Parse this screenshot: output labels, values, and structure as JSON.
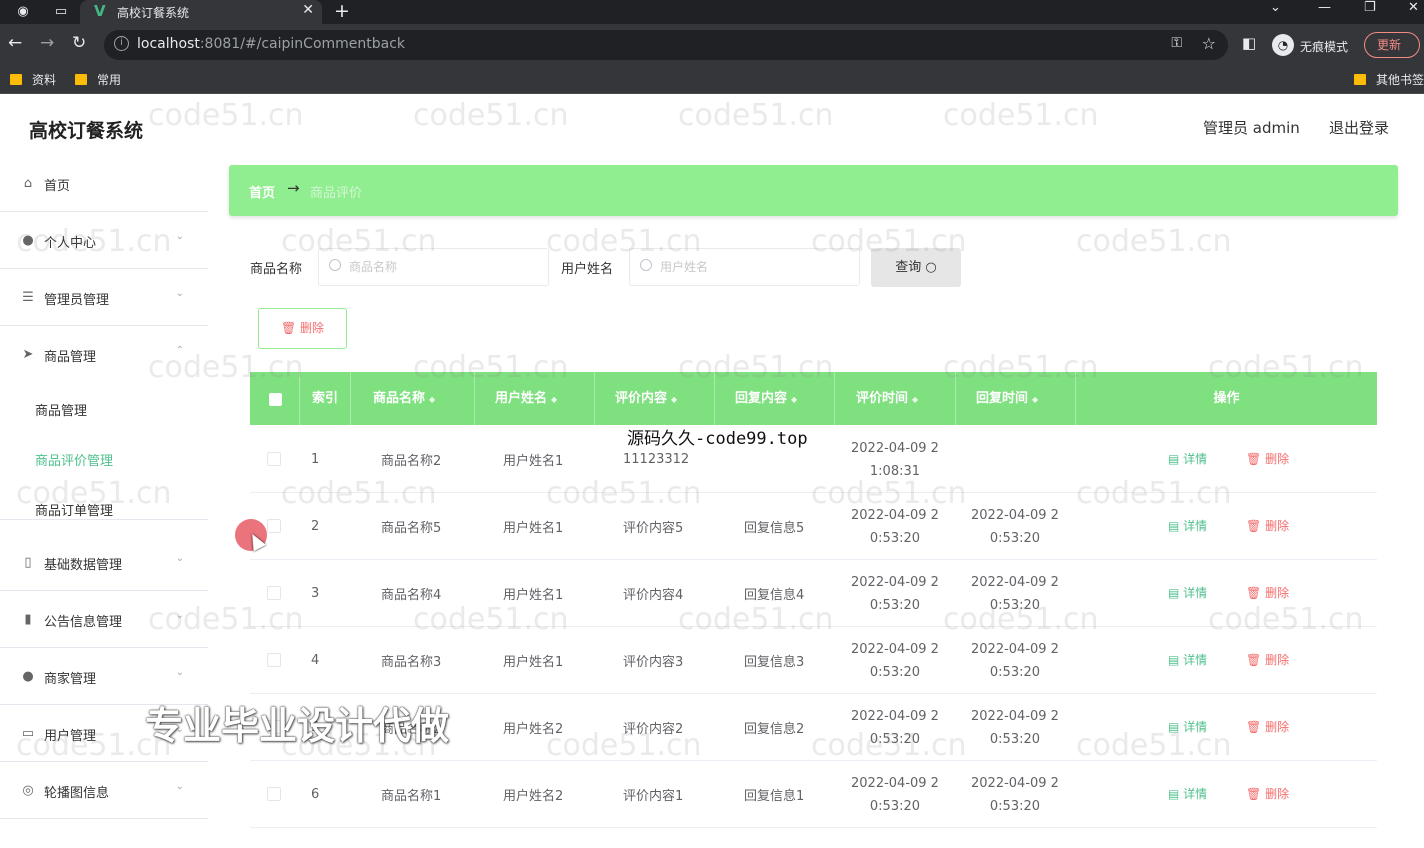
{
  "browser": {
    "tab_title": "高校订餐系统",
    "url_host": "localhost",
    "url_rest": ":8081/#/caipinCommentback",
    "incognito_label": "无痕模式",
    "update_label": "更新",
    "bookmarks": [
      "资料",
      "常用"
    ],
    "other_bookmarks": "其他书签"
  },
  "header": {
    "title": "高校订餐系统",
    "user": "管理员 admin",
    "logout": "退出登录"
  },
  "sidebar": {
    "items": [
      {
        "label": "首页",
        "icon": "home-icon"
      },
      {
        "label": "个人中心",
        "icon": "user-icon"
      },
      {
        "label": "管理员管理",
        "icon": "list-icon"
      },
      {
        "label": "商品管理",
        "icon": "send-icon"
      },
      {
        "label": "基础数据管理",
        "icon": "phone-icon"
      },
      {
        "label": "公告信息管理",
        "icon": "chart-icon"
      },
      {
        "label": "商家管理",
        "icon": "pin-icon"
      },
      {
        "label": "用户管理",
        "icon": "card-icon"
      },
      {
        "label": "轮播图信息",
        "icon": "image-icon"
      }
    ],
    "submenu": [
      "商品管理",
      "商品评价管理",
      "商品订单管理"
    ],
    "active_submenu": "商品评价管理"
  },
  "breadcrumb": {
    "home": "首页",
    "separator": "→",
    "current": "商品评价"
  },
  "search": {
    "name_label": "商品名称",
    "name_placeholder": "商品名称",
    "user_label": "用户姓名",
    "user_placeholder": "用户姓名",
    "query_label": "查询"
  },
  "actions": {
    "delete_label": "删除"
  },
  "table": {
    "headers": [
      "索引",
      "商品名称",
      "用户姓名",
      "评价内容",
      "回复内容",
      "评价时间",
      "回复时间",
      "操作"
    ],
    "detail_label": "详情",
    "delete_label": "删除",
    "rows": [
      {
        "index": "1",
        "name": "商品名称2",
        "user": "用户姓名1",
        "content": "11123312",
        "reply": "",
        "time1a": "2022-04-09 2",
        "time1b": "1:08:31",
        "time2a": "",
        "time2b": ""
      },
      {
        "index": "2",
        "name": "商品名称5",
        "user": "用户姓名1",
        "content": "评价内容5",
        "reply": "回复信息5",
        "time1a": "2022-04-09 2",
        "time1b": "0:53:20",
        "time2a": "2022-04-09 2",
        "time2b": "0:53:20"
      },
      {
        "index": "3",
        "name": "商品名称4",
        "user": "用户姓名1",
        "content": "评价内容4",
        "reply": "回复信息4",
        "time1a": "2022-04-09 2",
        "time1b": "0:53:20",
        "time2a": "2022-04-09 2",
        "time2b": "0:53:20"
      },
      {
        "index": "4",
        "name": "商品名称3",
        "user": "用户姓名1",
        "content": "评价内容3",
        "reply": "回复信息3",
        "time1a": "2022-04-09 2",
        "time1b": "0:53:20",
        "time2a": "2022-04-09 2",
        "time2b": "0:53:20"
      },
      {
        "index": "5",
        "name": "商品名称2",
        "user": "用户姓名2",
        "content": "评价内容2",
        "reply": "回复信息2",
        "time1a": "2022-04-09 2",
        "time1b": "0:53:20",
        "time2a": "2022-04-09 2",
        "time2b": "0:53:20"
      },
      {
        "index": "6",
        "name": "商品名称1",
        "user": "用户姓名2",
        "content": "评价内容1",
        "reply": "回复信息1",
        "time1a": "2022-04-09 2",
        "time1b": "0:53:20",
        "time2a": "2022-04-09 2",
        "time2b": "0:53:20"
      }
    ]
  },
  "overlays": {
    "watermark": "code51.cn",
    "source": "源码久久-code99.top",
    "ad": "专业毕业设计代做"
  },
  "colors": {
    "accent_green": "#90ee90",
    "header_green": "#7fe07f",
    "active_text": "#4fc08d",
    "danger": "#f56c6c"
  }
}
